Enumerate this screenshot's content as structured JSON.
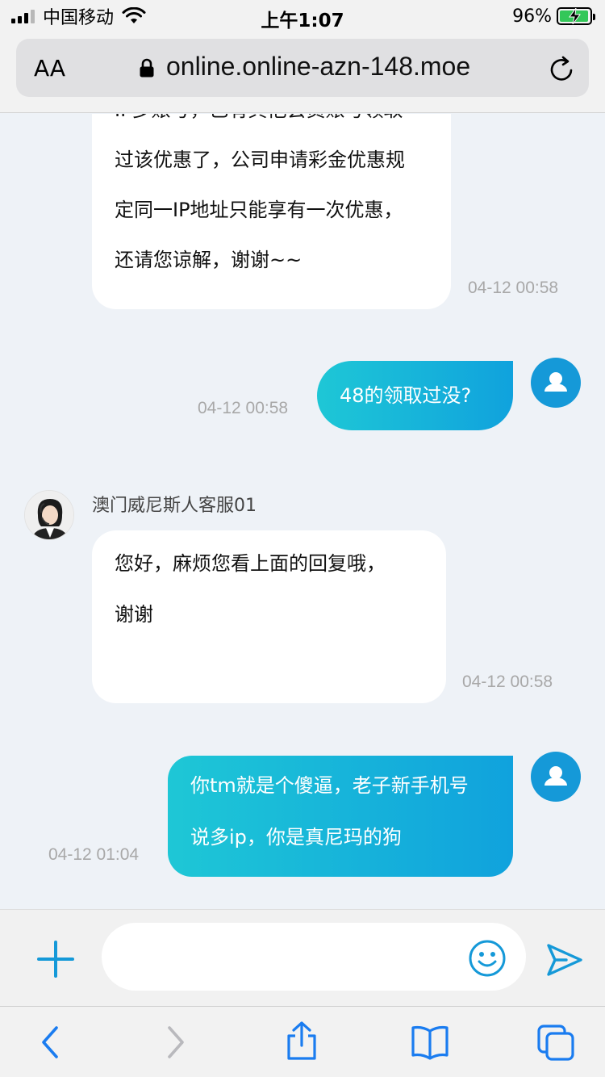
{
  "status_bar": {
    "carrier": "中国移动",
    "time": "上午1:07",
    "battery": "96%",
    "battery_level": 0.96
  },
  "browser": {
    "text_size_label": "AA",
    "url": "online.online-azn-148.moe"
  },
  "agent": {
    "name": "澳门威尼斯人客服01"
  },
  "messages": [
    {
      "from": "agent",
      "lines": [
        "IP多账号，已有其他会员账号领取",
        "过该优惠了，公司申请彩金优惠规",
        "定同一IP地址只能享有一次优惠，",
        "还请您谅解，谢谢~~"
      ],
      "time": "04-12 00:58"
    },
    {
      "from": "user",
      "lines": [
        "48的领取过没?"
      ],
      "time": "04-12 00:58"
    },
    {
      "from": "agent",
      "lines": [
        "您好，麻烦您看上面的回复哦，",
        "谢谢"
      ],
      "time": "04-12 00:58"
    },
    {
      "from": "user",
      "lines": [
        "你tm就是个傻逼，老子新手机号",
        "说多ip，你是真尼玛的狗"
      ],
      "time": "04-12 01:04"
    }
  ],
  "input": {
    "placeholder": ""
  },
  "colors": {
    "accent": "#1599d8",
    "bubble_gradient_start": "#1ec7d6",
    "bubble_gradient_end": "#10a2dd",
    "chat_background": "#eef2f7",
    "timestamp": "#a8a8a8"
  },
  "icons": {
    "status": [
      "signal-icon",
      "wifi-icon",
      "battery-icon"
    ],
    "browser": [
      "lock-icon",
      "reload-icon"
    ],
    "chat": [
      "user-avatar-icon",
      "agent-avatar"
    ],
    "input": [
      "plus-icon",
      "emoji-icon",
      "send-icon"
    ],
    "toolbar": [
      "back-icon",
      "forward-icon",
      "share-icon",
      "bookmarks-icon",
      "tabs-icon"
    ]
  }
}
